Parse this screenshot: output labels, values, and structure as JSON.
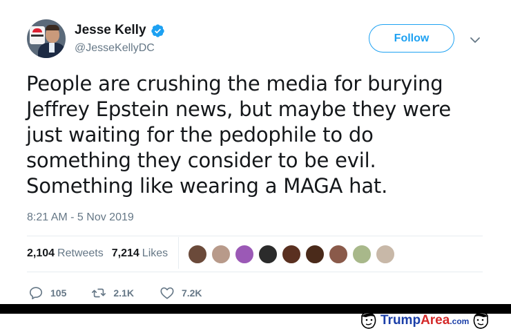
{
  "author": {
    "display_name": "Jesse Kelly",
    "handle": "@JesseKellyDC",
    "verified": true
  },
  "follow_button": {
    "label": "Follow"
  },
  "tweet": {
    "lines": [
      "People are crushing the media for burying",
      "Jeffrey Epstein news, but maybe they were",
      "just waiting for the pedophile to do",
      "something they consider to be evil.",
      "Something like wearing a MAGA hat."
    ],
    "timestamp": "8:21 AM - 5 Nov 2019"
  },
  "stats": {
    "retweets_count": "2,104",
    "retweets_label": "Retweets",
    "likes_count": "7,214",
    "likes_label": "Likes"
  },
  "liker_avatars": [
    {
      "name": "liker-1",
      "color": "#6b4a3a"
    },
    {
      "name": "liker-2",
      "color": "#b89a8a"
    },
    {
      "name": "liker-3",
      "color": "#9b59b6"
    },
    {
      "name": "liker-4",
      "color": "#2b2b2b"
    },
    {
      "name": "liker-5",
      "color": "#5a3020"
    },
    {
      "name": "liker-6",
      "color": "#4a2a1a"
    },
    {
      "name": "liker-7",
      "color": "#8a5a4a"
    },
    {
      "name": "liker-8",
      "color": "#a8b88a"
    },
    {
      "name": "liker-9",
      "color": "#c8b8a8"
    }
  ],
  "actions": {
    "reply_count": "105",
    "retweet_count": "2.1K",
    "like_count": "7.2K"
  },
  "watermark": {
    "part1": "Trump",
    "part2": "Area",
    "part3": ".com"
  },
  "colors": {
    "accent": "#1da1f2",
    "muted": "#657786",
    "text": "#14171a",
    "divider": "#e6ecf0"
  },
  "icons": [
    "verified-badge-icon",
    "chevron-down-icon",
    "reply-icon",
    "retweet-icon",
    "heart-icon"
  ]
}
